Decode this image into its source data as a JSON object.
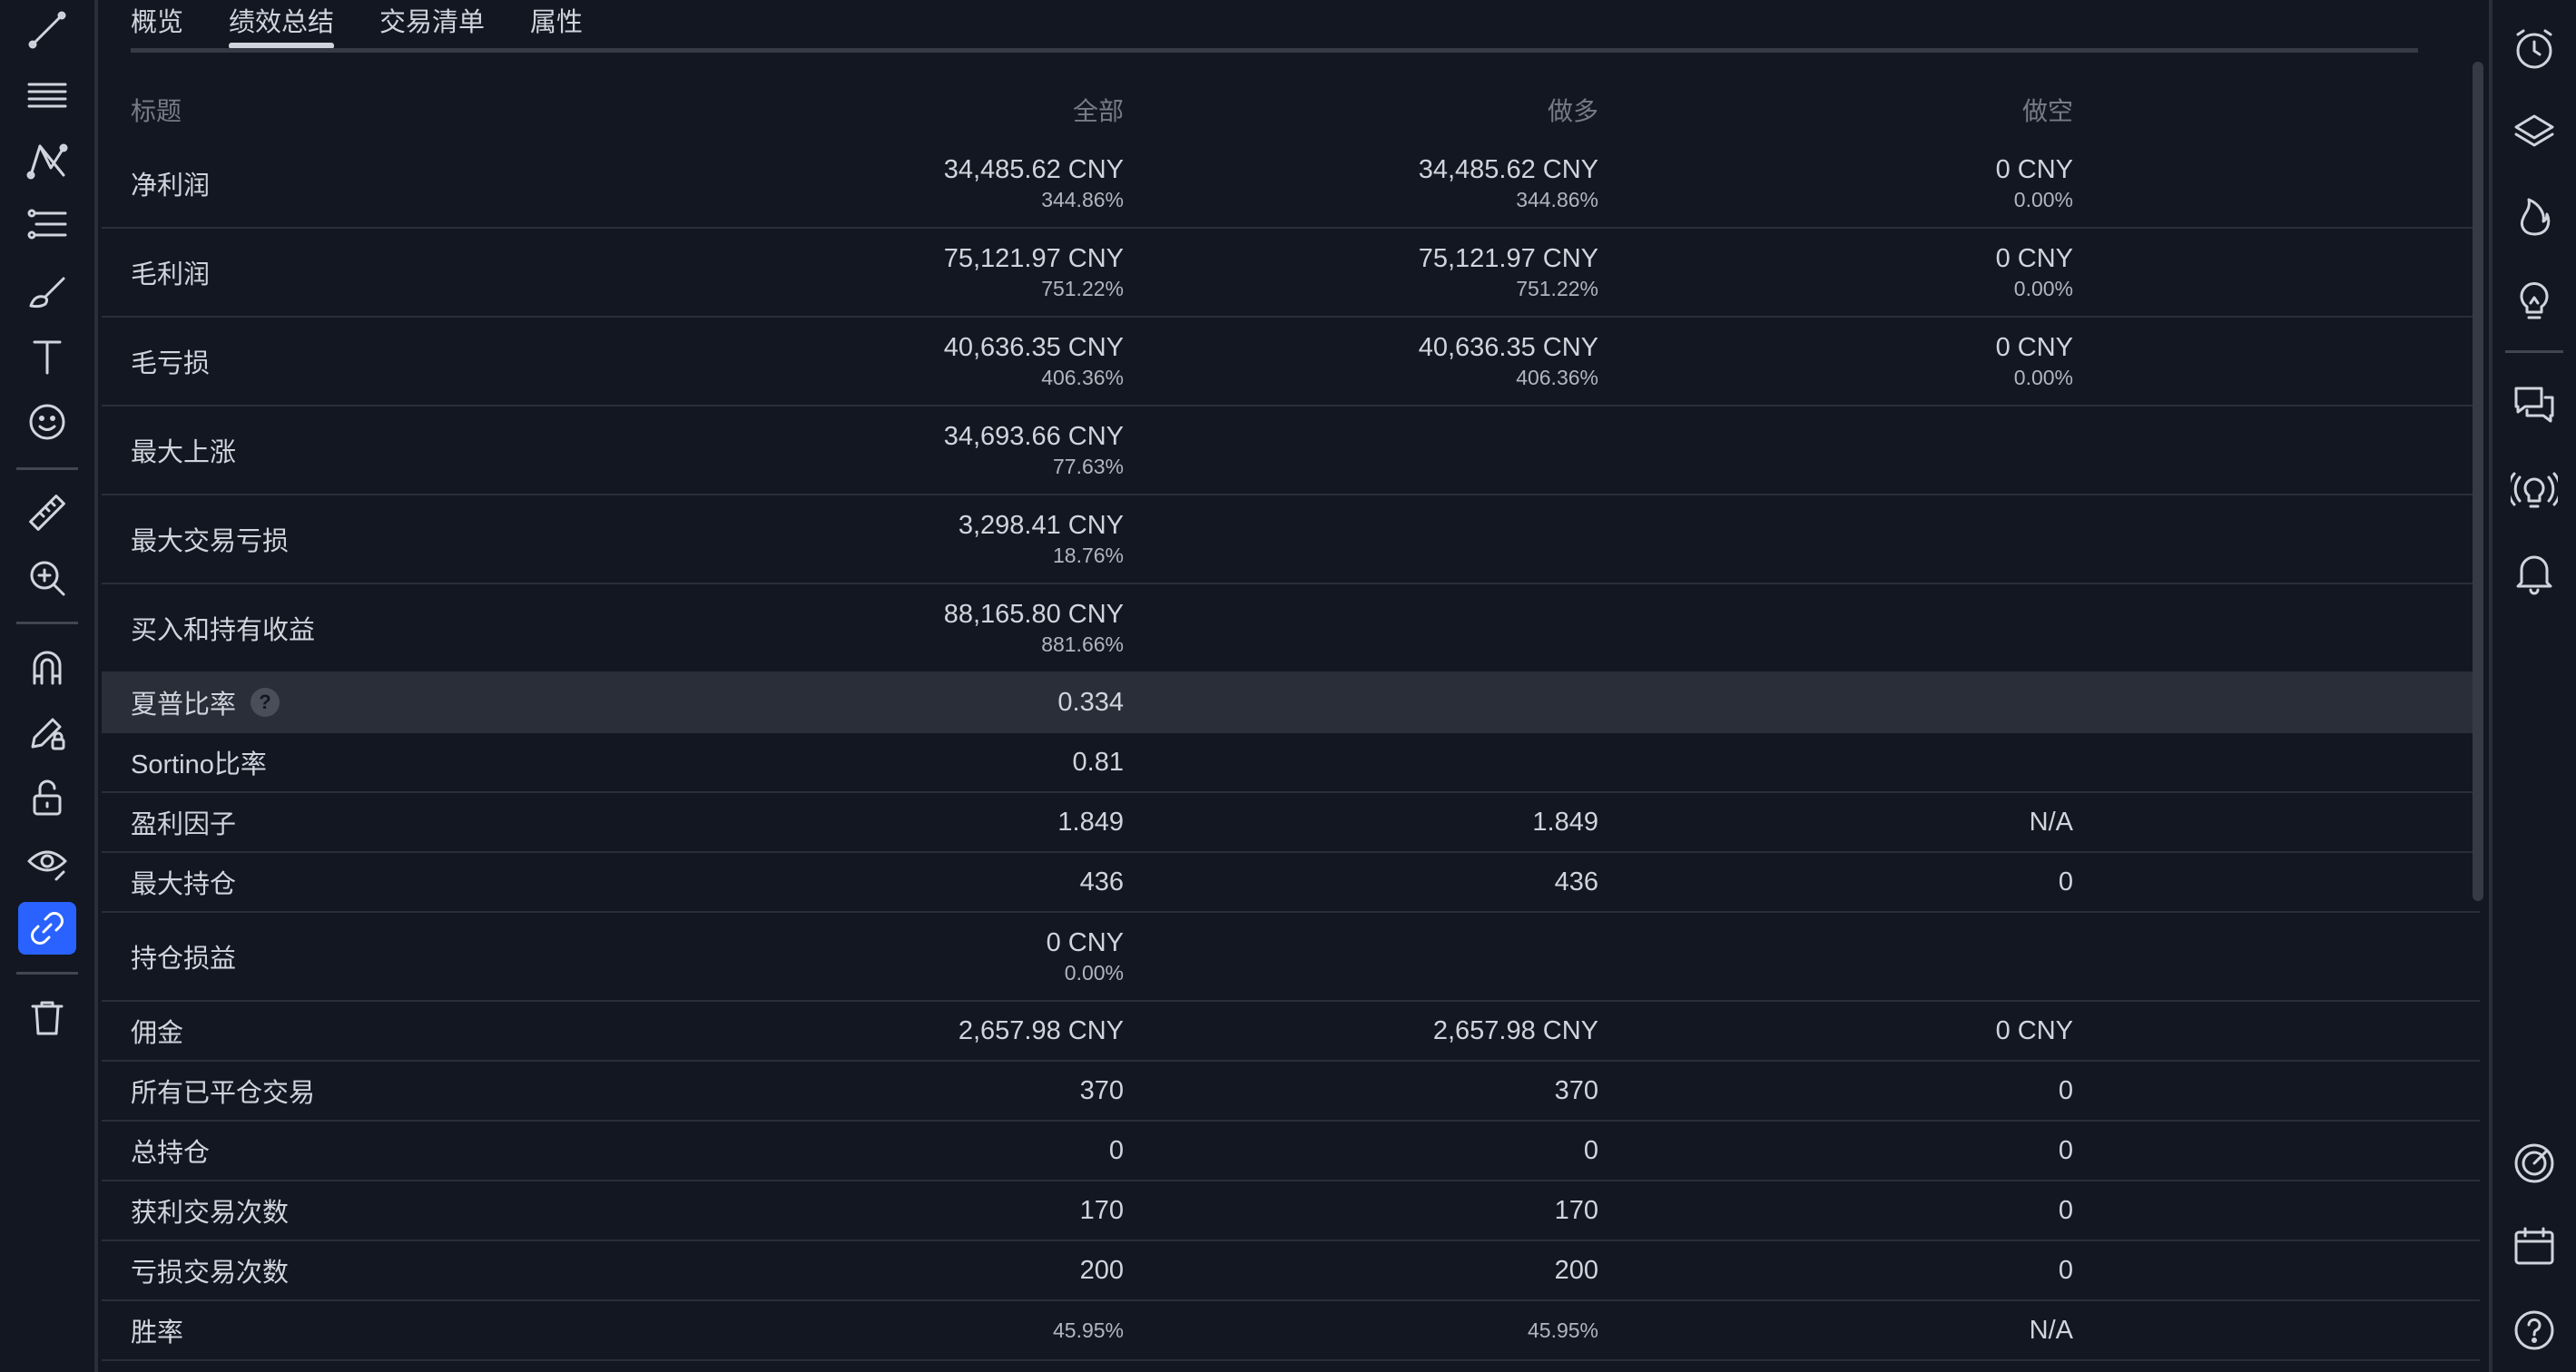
{
  "tabs": [
    "概览",
    "绩效总结",
    "交易清单",
    "属性"
  ],
  "active_tab": "绩效总结",
  "columns": {
    "title": "标题",
    "all": "全部",
    "long": "做多",
    "short": "做空"
  },
  "rows": [
    {
      "title": "净利润",
      "all": "34,485.62 CNY",
      "all_pct": "344.86%",
      "long": "34,485.62 CNY",
      "long_pct": "344.86%",
      "short": "0 CNY",
      "short_pct": "0.00%"
    },
    {
      "title": "毛利润",
      "all": "75,121.97 CNY",
      "all_pct": "751.22%",
      "long": "75,121.97 CNY",
      "long_pct": "751.22%",
      "short": "0 CNY",
      "short_pct": "0.00%"
    },
    {
      "title": "毛亏损",
      "all": "40,636.35 CNY",
      "all_pct": "406.36%",
      "long": "40,636.35 CNY",
      "long_pct": "406.36%",
      "short": "0 CNY",
      "short_pct": "0.00%"
    },
    {
      "title": "最大上涨",
      "all": "34,693.66 CNY",
      "all_pct": "77.63%"
    },
    {
      "title": "最大交易亏损",
      "all": "3,298.41 CNY",
      "all_pct": "18.76%"
    },
    {
      "title": "买入和持有收益",
      "all": "88,165.80 CNY",
      "all_pct": "881.66%"
    },
    {
      "title": "夏普比率",
      "help": "?",
      "all": "0.334"
    },
    {
      "title": "Sortino比率",
      "all": "0.81"
    },
    {
      "title": "盈利因子",
      "all": "1.849",
      "long": "1.849",
      "short": "N/A"
    },
    {
      "title": "最大持仓",
      "all": "436",
      "long": "436",
      "short": "0"
    },
    {
      "title": "持仓损益",
      "all": "0 CNY",
      "all_pct": "0.00%"
    },
    {
      "title": "佣金",
      "all": "2,657.98 CNY",
      "long": "2,657.98 CNY",
      "short": "0 CNY"
    },
    {
      "title": "所有已平仓交易",
      "all": "370",
      "long": "370",
      "short": "0"
    },
    {
      "title": "总持仓",
      "all": "0",
      "long": "0",
      "short": "0"
    },
    {
      "title": "获利交易次数",
      "all": "170",
      "long": "170",
      "short": "0"
    },
    {
      "title": "亏损交易次数",
      "all": "200",
      "long": "200",
      "short": "0"
    },
    {
      "title": "胜率",
      "all_pct": "45.95%",
      "long_pct": "45.95%",
      "short": "N/A"
    }
  ],
  "left_toolbar": [
    "trend-line-icon",
    "horizontal-lines-icon",
    "pattern-icon",
    "fib-icon",
    "brush-icon",
    "text-icon",
    "emoji-icon",
    "ruler-icon",
    "zoom-in-icon",
    "magnet-icon",
    "pencil-lock-icon",
    "unlock-icon",
    "eye-icon",
    "link-icon",
    "trash-icon"
  ],
  "right_toolbar": [
    "alarm-clock-icon",
    "layers-icon",
    "fire-icon",
    "lightbulb-icon",
    "chat-icon",
    "broadcast-icon",
    "bell-icon",
    "target-icon",
    "calendar-icon",
    "help-icon"
  ],
  "colors": {
    "background": "#131722",
    "text": "#d1d4dc",
    "muted": "#787b86",
    "accent": "#2962ff",
    "highlight": "#2a2e39"
  }
}
